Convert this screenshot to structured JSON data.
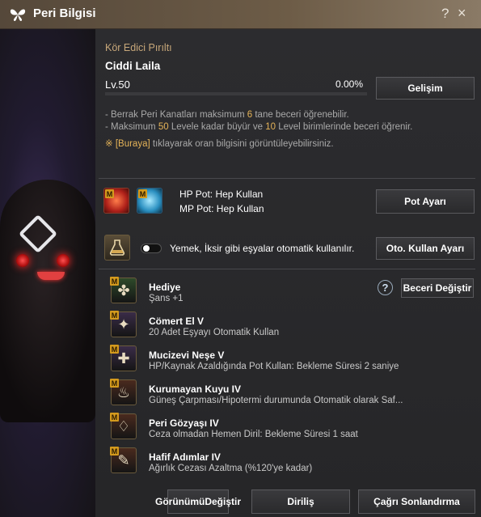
{
  "window": {
    "title": "Peri Bilgisi",
    "help_symbol": "?",
    "close_symbol": "×"
  },
  "peri": {
    "type_name": "Kör Edici Pırıltı",
    "name": "Ciddi Laila",
    "level": "Lv.50",
    "progress_text": "0.00%",
    "progress_value": 0.0,
    "evolve_button": "Gelişim"
  },
  "info_lines": {
    "line1_prefix": "- Berrak Peri Kanatları maksimum",
    "line1_num": "6",
    "line1_suffix": "tane beceri öğrenebilir.",
    "line2_prefix": "- Maksimum",
    "line2_num1": "50",
    "line2_mid": "Levele kadar büyür ve",
    "line2_num2": "10",
    "line2_suffix": "Level birimlerinde beceri öğrenir.",
    "line3_mark": "※",
    "line3_link": "[Buraya]",
    "line3_suffix": "tıklayarak oran bilgisini görüntüleyebilirsiniz."
  },
  "potions": {
    "hp_text": "HP Pot: Hep Kullan",
    "mp_text": "MP Pot: Hep Kullan",
    "settings_button": "Pot Ayarı",
    "hp_icon": "hp-potion-icon",
    "mp_icon": "mp-potion-icon",
    "badge": "M"
  },
  "auto_use": {
    "label": "Yemek, İksir gibi eşyalar otomatik kullanılır.",
    "button": "Oto. Kullan Ayarı",
    "icon": "potion-flask-icon"
  },
  "skills": {
    "help_symbol": "?",
    "change_button": "Beceri Değiştir",
    "badge": "M",
    "items": [
      {
        "name": "Hediye",
        "desc": "Şans +1",
        "icon": "clover-icon"
      },
      {
        "name": "Cömert El V",
        "desc": "20 Adet Eşyayı Otomatik Kullan",
        "icon": "fairy-icon"
      },
      {
        "name": "Mucizevi Neşe V",
        "desc": "HP/Kaynak Azaldığında Pot Kullan: Bekleme Süresi 2 saniye",
        "icon": "potion-plus-icon"
      },
      {
        "name": "Kurumayan Kuyu IV",
        "desc": "Güneş Çarpması/Hipotermi durumunda Otomatik olarak Saf...",
        "icon": "bowl-icon"
      },
      {
        "name": "Peri Gözyaşı IV",
        "desc": "Ceza olmadan Hemen Diril: Bekleme Süresi 1 saat",
        "icon": "tear-vial-icon"
      },
      {
        "name": "Hafif Adımlar IV",
        "desc": "Ağırlık Cezası Azaltma (%120'ye kadar)",
        "icon": "scroll-icon"
      }
    ]
  },
  "footer": {
    "view_change_line1": "Görünümü",
    "view_change_line2": "Değiştir",
    "revive": "Diriliş",
    "end_summon": "Çağrı Sonlandırma"
  },
  "colors": {
    "titlebar": "#6d5c47",
    "accent_gold": "#c8a87a",
    "highlight_yellow": "#e6b458",
    "badge_orange": "#d49a1d"
  }
}
